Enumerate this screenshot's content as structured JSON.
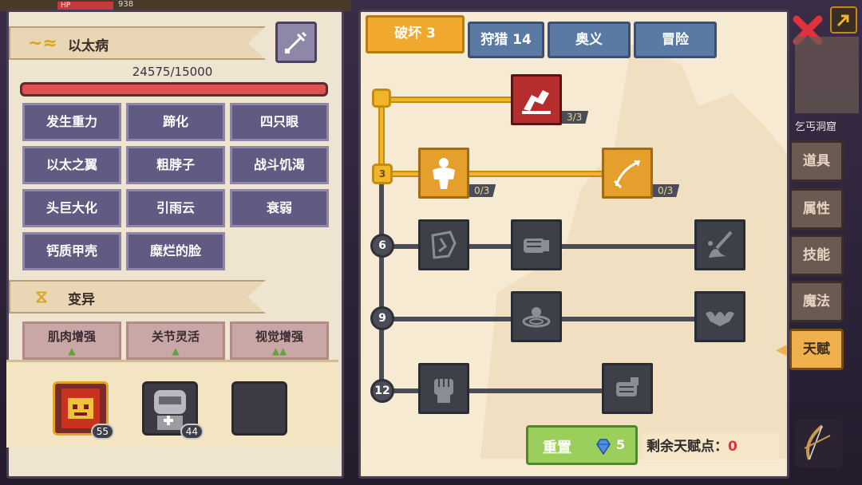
{
  "hud": {
    "hp_label": "HP",
    "hp_value": "938"
  },
  "left": {
    "disease_title": "以太病",
    "disease_progress": "24575/15000",
    "diseases": [
      "发生重力",
      "蹄化",
      "四只眼",
      "以太之翼",
      "粗脖子",
      "战斗饥渴",
      "头巨大化",
      "引雨云",
      "衰弱",
      "钙质甲壳",
      "糜烂的脸"
    ],
    "mutation_title": "变异",
    "mutations": [
      {
        "label": "肌肉增强",
        "arrows": "▲"
      },
      {
        "label": "关节灵活",
        "arrows": "▲"
      },
      {
        "label": "视觉增强",
        "arrows": "▲▲"
      }
    ],
    "slots": [
      {
        "level": "55"
      },
      {
        "level": "44"
      },
      {
        "level": ""
      }
    ]
  },
  "tabs": [
    {
      "label": "破坏 3",
      "active": true
    },
    {
      "label": "狩猎 14",
      "active": false
    },
    {
      "label": "奥义",
      "active": false
    },
    {
      "label": "冒险",
      "active": false
    }
  ],
  "tiers": [
    "3",
    "6",
    "9",
    "12"
  ],
  "talents": [
    {
      "icon": "arm-wrestle-icon",
      "count": "3/3"
    },
    {
      "icon": "muscle-body-icon",
      "count": "0/3"
    },
    {
      "icon": "arrow-icon",
      "count": "0/3"
    },
    {
      "icon": "rock-break-icon"
    },
    {
      "icon": "punch-icon"
    },
    {
      "icon": "splash-icon"
    },
    {
      "icon": "ripple-icon"
    },
    {
      "icon": "bat-icon"
    },
    {
      "icon": "fist-icon"
    },
    {
      "icon": "fist-grab-icon"
    }
  ],
  "reset": {
    "label": "重置",
    "cost": "5"
  },
  "remaining": {
    "label": "剩余天赋点：",
    "value": "0"
  },
  "side_tabs": [
    "道具",
    "属性",
    "技能",
    "魔法",
    "天赋"
  ],
  "location": "乞丐洞窟",
  "colors": {
    "accent": "#f0a92c",
    "tab_blue": "#5b7aa3",
    "close_red": "#e0323a",
    "remaining_red": "#e0323a"
  }
}
